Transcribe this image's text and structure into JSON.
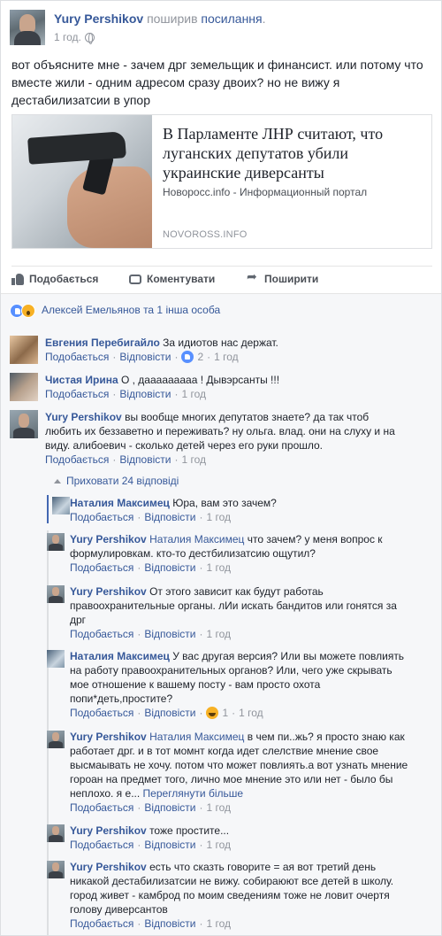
{
  "post": {
    "author": "Yury Pershikov",
    "action": "поширив",
    "action_link": "посилання",
    "time": "1 год.",
    "text": "вот объясните мне - зачем дрг земельщик и финансист. или потому что вместе жили - одним адресом сразу двоих? но не вижу я дестабилизатсии в упор",
    "card": {
      "title": "В Парламенте ЛНР считают, что луганских депутатов убили украинские диверсанты",
      "description": "Новоросс.info - Информационный портал",
      "domain": "NOVOROSS.INFO"
    },
    "actions": {
      "like": "Подобається",
      "comment": "Коментувати",
      "share": "Поширити"
    },
    "likes_text": "Алексей Емельянов та 1 інша особа"
  },
  "labels": {
    "like": "Подобається",
    "reply": "Відповісти",
    "see_more": "Переглянути більше",
    "hide_replies": "Приховати 24 відповіді"
  },
  "comments": [
    {
      "name": "Евгения Перебигайло",
      "text": "За идиотов нас держат.",
      "likes": "2",
      "time": "1 год"
    },
    {
      "name": "Чистая Ирина",
      "text": "О , дааааааааа ! Дывэрсанты !!!",
      "time": "1 год"
    },
    {
      "name": "Yury Pershikov",
      "text": "вы вообще многих депутатов знаете? да так чтоб любить их беззаветно и переживать? ну ольга. влад. они на слуху и на виду. алибоевич - сколько детей через его руки прошло.",
      "time": "1 год"
    }
  ],
  "replies": [
    {
      "name": "Наталия Максимец",
      "text": "Юра, вам это зачем?",
      "time": "1 год"
    },
    {
      "name": "Yury Pershikov",
      "mention": "Наталия Максимец",
      "text": "что зачем? у меня вопрос к формулировкам. кто-то дестбилизатсию ощутил?",
      "time": "1 год"
    },
    {
      "name": "Yury Pershikov",
      "text": "От этого зависит как будут работаь правоохранительные органы. лИи искать бандитов или гонятся за дрг",
      "time": "1 год"
    },
    {
      "name": "Наталия Максимец",
      "text": "У вас другая версия? Или вы можете повлиять на работу правоохранительных органов? Или, чего уже скрывать мое отношение к вашему посту - вам просто охота попи*деть,простите?",
      "likes": "1",
      "time": "1 год"
    },
    {
      "name": "Yury Pershikov",
      "mention": "Наталия Максимец",
      "text": "в чем пи..жь? я просто знаю как работает дрг. и в тот момнт когда идет слелствие мнение свое высмаывать не хочу. потом что может повлиять.а вот узнать мнение гороан на предмет того, лично мое мнение это или нет - было бы неплохо. я е...",
      "time": "1 год"
    },
    {
      "name": "Yury Pershikov",
      "text": "тоже простите...",
      "time": "1 год"
    },
    {
      "name": "Yury Pershikov",
      "text": "есть что сказть говорите = ая вот третий день никакой дестабилизатсии не вижу. собираюют все детей в школу. город живет - камброд по моим сведениям тоже не ловит очертя голову диверсантов",
      "time": "1 год"
    }
  ]
}
